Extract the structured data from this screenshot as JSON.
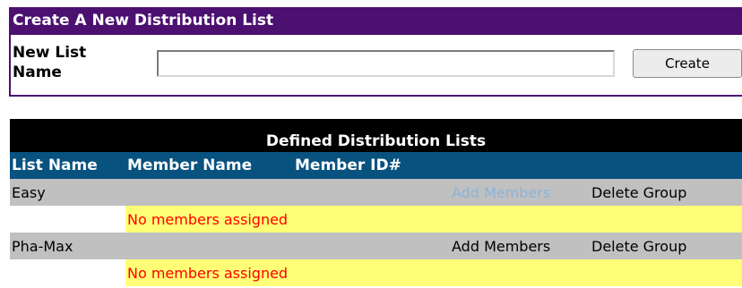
{
  "create_panel": {
    "title": "Create A New Distribution List",
    "new_list_label": "New List Name",
    "new_list_value": "",
    "create_button_label": "Create"
  },
  "lists_table": {
    "title": "Defined Distribution Lists",
    "columns": [
      "List Name",
      "Member Name",
      "Member ID#"
    ],
    "groups": [
      {
        "name": "Easy",
        "add_members_label": "Add Members",
        "add_members_enabled": false,
        "delete_group_label": "Delete Group",
        "members_note": "No members assigned"
      },
      {
        "name": "Pha-Max",
        "add_members_label": "Add Members",
        "add_members_enabled": true,
        "delete_group_label": "Delete Group",
        "members_note": "No members assigned"
      }
    ]
  },
  "colors": {
    "header_purple": "#4b1070",
    "column_header_blue": "#085280",
    "group_row_gray": "#c0c0c0",
    "note_yellow": "#ffff77",
    "note_red": "#ff0000",
    "link_blue": "#0055aa",
    "link_disabled": "#8db2d6"
  }
}
